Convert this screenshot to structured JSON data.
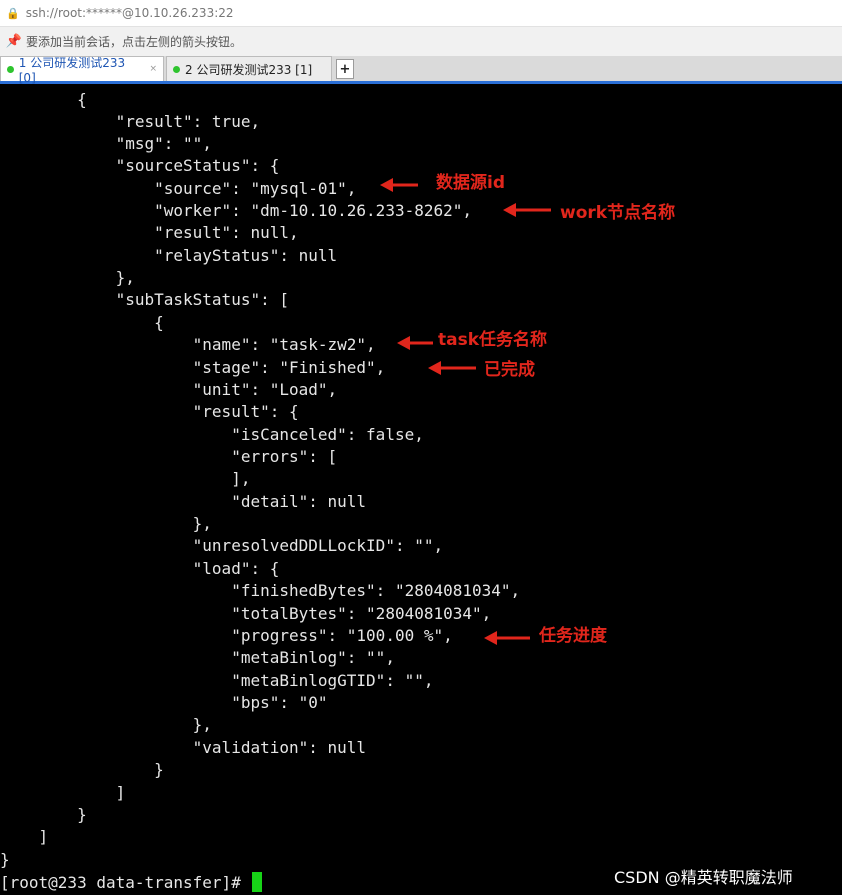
{
  "window": {
    "address": "ssh://root:******@10.10.26.233:22",
    "hint": "要添加当前会话，点击左侧的箭头按钮。"
  },
  "tabs": [
    {
      "label": "1 公司研发测试233 [0]",
      "close": "×",
      "active": true,
      "status_color": "#2ec42e"
    },
    {
      "label": "2 公司研发测试233 [1]",
      "close": "",
      "active": false,
      "status_color": "#2ec42e"
    }
  ],
  "new_tab_label": "+",
  "terminal": {
    "lines": [
      "        {",
      "            \"result\": true,",
      "            \"msg\": \"\",",
      "            \"sourceStatus\": {",
      "                \"source\": \"mysql-01\",",
      "                \"worker\": \"dm-10.10.26.233-8262\",",
      "                \"result\": null,",
      "                \"relayStatus\": null",
      "            },",
      "            \"subTaskStatus\": [",
      "                {",
      "                    \"name\": \"task-zw2\",",
      "                    \"stage\": \"Finished\",",
      "                    \"unit\": \"Load\",",
      "                    \"result\": {",
      "                        \"isCanceled\": false,",
      "                        \"errors\": [",
      "                        ],",
      "                        \"detail\": null",
      "                    },",
      "                    \"unresolvedDDLLockID\": \"\",",
      "                    \"load\": {",
      "                        \"finishedBytes\": \"2804081034\",",
      "                        \"totalBytes\": \"2804081034\",",
      "                        \"progress\": \"100.00 %\",",
      "                        \"metaBinlog\": \"\",",
      "                        \"metaBinlogGTID\": \"\",",
      "                        \"bps\": \"0\"",
      "                    },",
      "                    \"validation\": null",
      "                }",
      "            ]",
      "        }",
      "    ]",
      "}"
    ],
    "prompt": "[root@233 data-transfer]# "
  },
  "annotations": {
    "source": "数据源id",
    "worker": "work节点名称",
    "name": "task任务名称",
    "stage": "已完成",
    "progress": "任务进度",
    "color": "#e1261c"
  },
  "watermark": "CSDN @精英转职魔法师"
}
